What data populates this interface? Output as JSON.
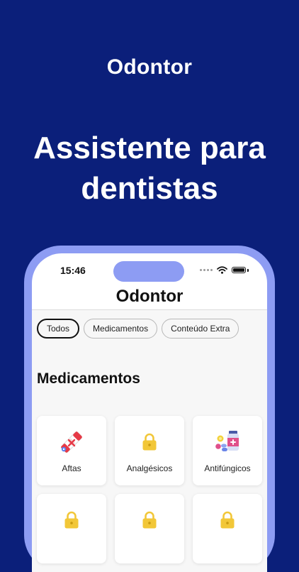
{
  "brand": "Odontor",
  "headline": [
    "Assistente para",
    "dentistas"
  ],
  "status_bar": {
    "time": "15:46"
  },
  "app": {
    "title": "Odontor",
    "filters": [
      {
        "label": "Todos",
        "active": true
      },
      {
        "label": "Medicamentos",
        "active": false
      },
      {
        "label": "Conteúdo Extra",
        "active": false
      }
    ],
    "section_title": "Medicamentos",
    "cards": [
      {
        "label": "Aftas",
        "icon": "pill-bandage-icon"
      },
      {
        "label": "Analgésicos",
        "icon": "lock-icon"
      },
      {
        "label": "Antifúngicos",
        "icon": "medicine-bottle-icon"
      },
      {
        "label": "",
        "icon": "lock-icon"
      },
      {
        "label": "",
        "icon": "lock-icon"
      },
      {
        "label": "",
        "icon": "lock-icon"
      }
    ]
  },
  "colors": {
    "background": "#0b1f7a",
    "phone_frame": "#8d9cf3",
    "lock": "#f2c738"
  }
}
